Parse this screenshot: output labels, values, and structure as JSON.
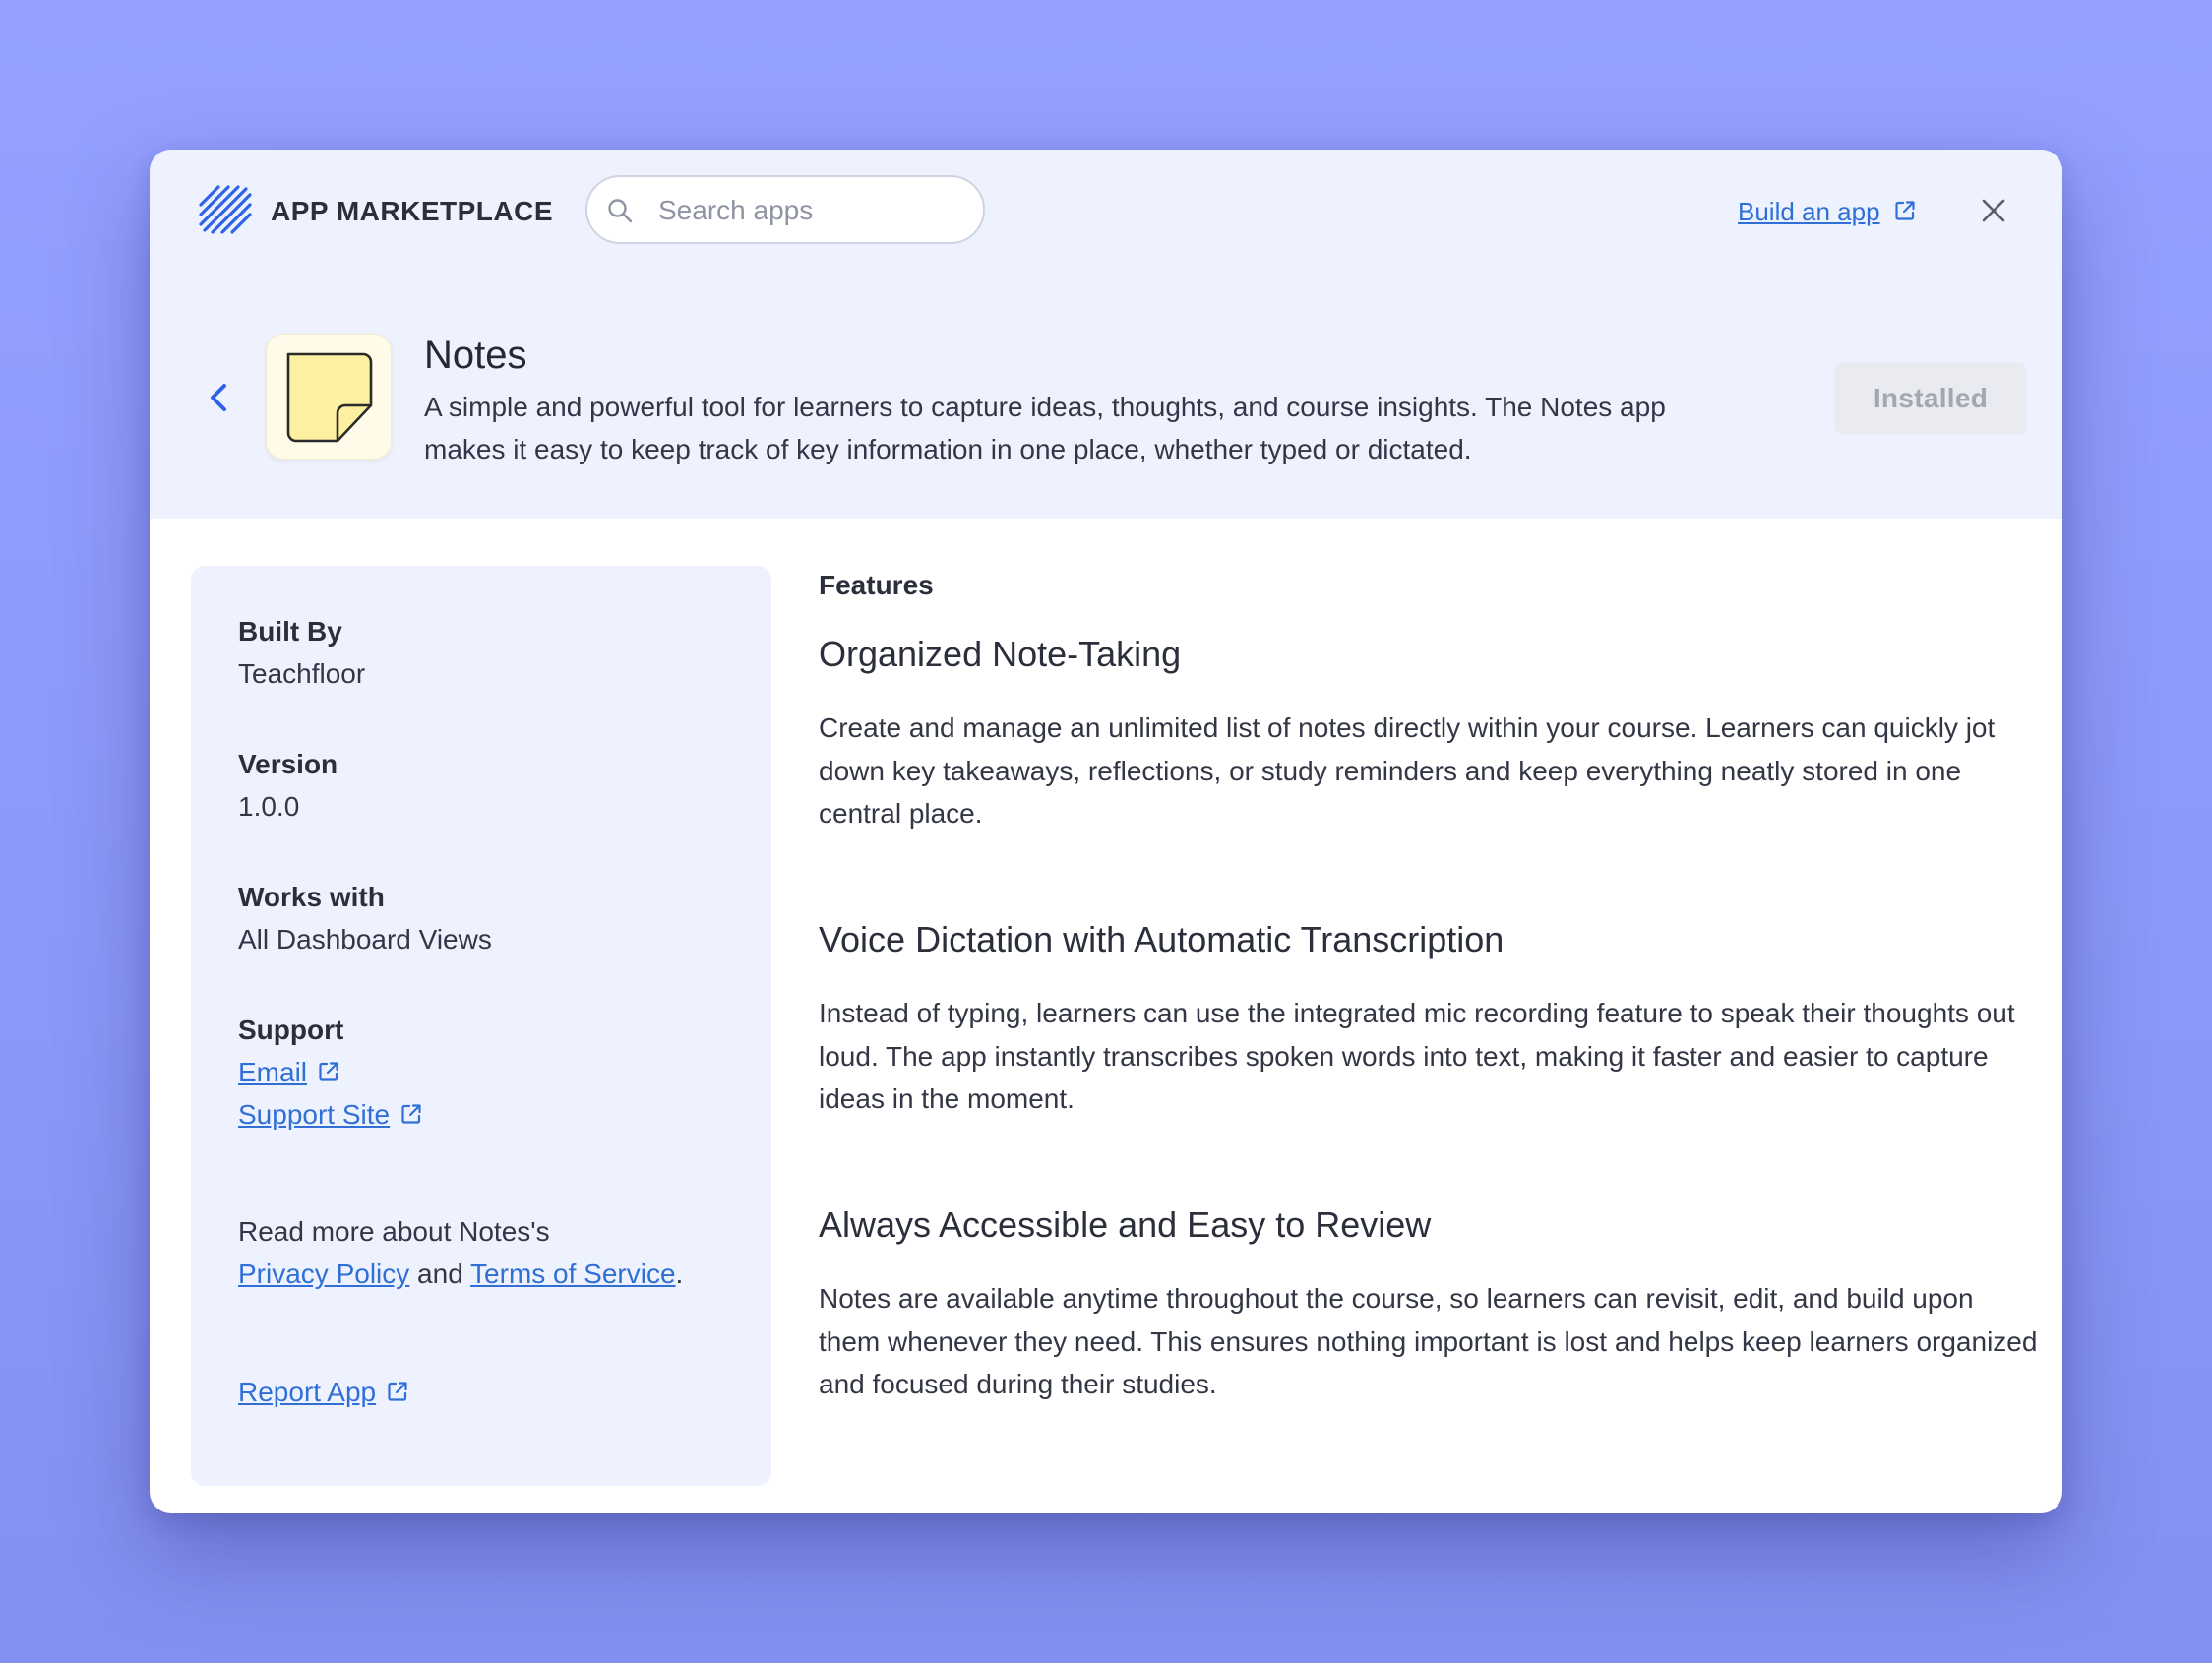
{
  "header": {
    "brand": "APP MARKETPLACE",
    "search_placeholder": "Search apps",
    "build_link": "Build an app"
  },
  "app": {
    "title": "Notes",
    "description": "A simple and powerful tool for learners to capture ideas, thoughts, and course insights. The Notes app makes it easy to keep track of key information in one place, whether typed or dictated.",
    "status_button": "Installed"
  },
  "sidebar": {
    "built_by_label": "Built By",
    "built_by_value": "Teachfloor",
    "version_label": "Version",
    "version_value": "1.0.0",
    "works_with_label": "Works with",
    "works_with_value": "All Dashboard Views",
    "support_label": "Support",
    "email_link": "Email",
    "support_site_link": "Support Site",
    "read_more": "Read more about Notes's",
    "privacy_link": "Privacy Policy",
    "and_text": "and",
    "terms_link": "Terms of Service",
    "period": ".",
    "report_link": "Report App"
  },
  "features": {
    "label": "Features",
    "items": [
      {
        "title": "Organized Note-Taking",
        "body": "Create and manage an unlimited list of notes directly within your course. Learners can quickly jot down key takeaways, reflections, or study reminders and keep everything neatly stored in one central place."
      },
      {
        "title": "Voice Dictation with Automatic Transcription",
        "body": "Instead of typing, learners can use the integrated mic recording feature to speak their thoughts out loud. The app instantly transcribes spoken words into text, making it faster and easier to capture ideas in the moment."
      },
      {
        "title": "Always Accessible and Easy to Review",
        "body": "Notes are available anytime throughout the course, so learners can revisit, edit, and build upon them whenever they need. This ensures nothing important is lost and helps keep learners organized and focused during their studies."
      }
    ]
  },
  "colors": {
    "background": "#95a0ff",
    "header_bg": "#eef2fe",
    "link": "#2f6fd6",
    "logo": "#2e62e8",
    "installed_bg": "#e9ebf1",
    "note_yellow": "#fdf0a0"
  },
  "icons": {
    "logo": "diagonal-stripes-logo",
    "search": "search-icon",
    "external": "external-link-icon",
    "close": "close-icon",
    "back": "chevron-left-icon",
    "app": "sticky-note-icon"
  }
}
